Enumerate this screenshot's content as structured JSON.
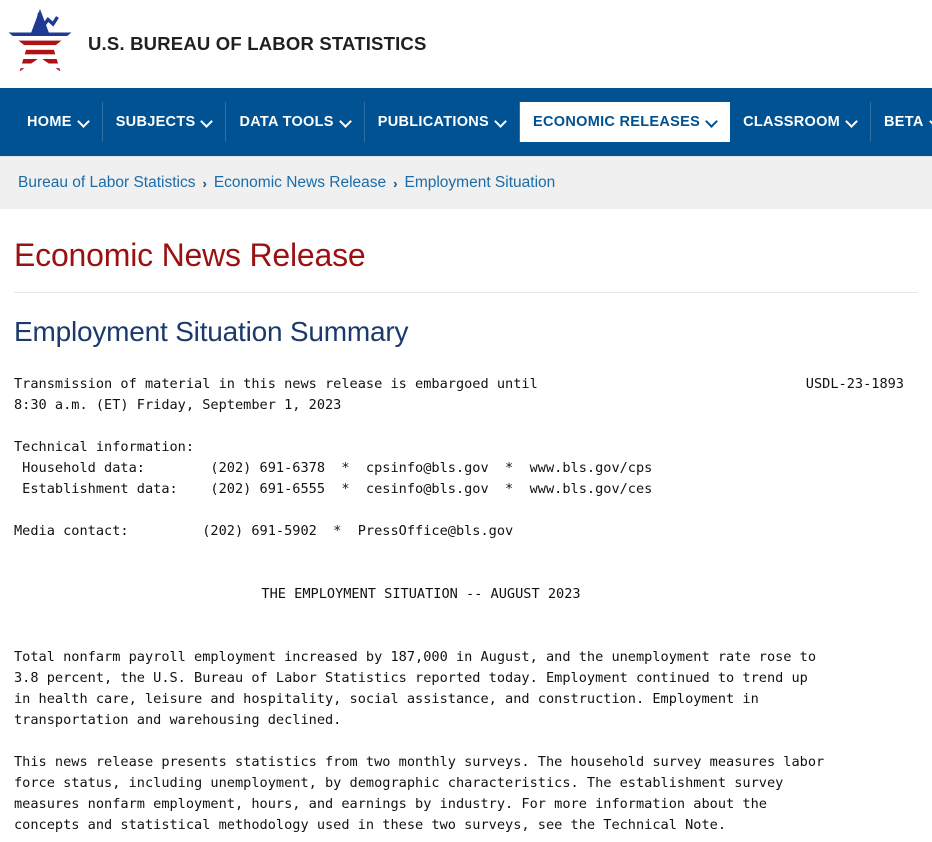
{
  "masthead": {
    "agency_name": "U.S. BUREAU OF LABOR STATISTICS",
    "logo_icon": "bls-star-chart-logo"
  },
  "nav": {
    "items": [
      {
        "label": "HOME",
        "has_caret": true,
        "active": false
      },
      {
        "label": "SUBJECTS",
        "has_caret": true,
        "active": false
      },
      {
        "label": "DATA TOOLS",
        "has_caret": true,
        "active": false
      },
      {
        "label": "PUBLICATIONS",
        "has_caret": true,
        "active": false
      },
      {
        "label": "ECONOMIC RELEASES",
        "has_caret": true,
        "active": true
      },
      {
        "label": "CLASSROOM",
        "has_caret": true,
        "active": false
      },
      {
        "label": "BETA",
        "has_caret": true,
        "active": false
      }
    ],
    "background_color": "#005293",
    "active_background_color": "#ffffff",
    "active_text_color": "#00518f"
  },
  "breadcrumb": {
    "items": [
      "Bureau of Labor Statistics",
      "Economic News Release",
      "Employment Situation"
    ],
    "separator": "›",
    "link_color": "#1b6ca8",
    "background_color": "#f0f0f0"
  },
  "page": {
    "release_title": "Economic News Release",
    "release_title_color": "#9b1111",
    "heading": "Employment Situation Summary",
    "heading_color": "#1b3a6b"
  },
  "release": {
    "embargo_line_1": "Transmission of material in this news release is embargoed until",
    "embargo_line_2": "8:30 a.m. (ET) Friday, September 1, 2023",
    "usdl_number": "USDL-23-1893",
    "technical_information_label": "Technical information:",
    "contacts": [
      {
        "label": " Household data:",
        "phone": "(202) 691-6378",
        "email": "cpsinfo@bls.gov",
        "url": "www.bls.gov/cps"
      },
      {
        "label": " Establishment data:",
        "phone": "(202) 691-6555",
        "email": "cesinfo@bls.gov",
        "url": "www.bls.gov/ces"
      }
    ],
    "media_contact": {
      "label": "Media contact:",
      "phone": "(202) 691-5902",
      "email": "PressOffice@bls.gov"
    },
    "contact_block": " Household data:        (202) 691-6378  *  cpsinfo@bls.gov  *  www.bls.gov/cps\n Establishment data:    (202) 691-6555  *  cesinfo@bls.gov  *  www.bls.gov/ces",
    "media_contact_line": "Media contact:         (202) 691-5902  *  PressOffice@bls.gov",
    "centered_title": "THE EMPLOYMENT SITUATION -- AUGUST 2023",
    "paragraph_1": "Total nonfarm payroll employment increased by 187,000 in August, and the unemployment rate rose to\n3.8 percent, the U.S. Bureau of Labor Statistics reported today. Employment continued to trend up\nin health care, leisure and hospitality, social assistance, and construction. Employment in\ntransportation and warehousing declined.",
    "paragraph_2": "This news release presents statistics from two monthly surveys. The household survey measures labor\nforce status, including unemployment, by demographic characteristics. The establishment survey\nmeasures nonfarm employment, hours, and earnings by industry. For more information about the\nconcepts and statistical methodology used in these two surveys, see the Technical Note."
  }
}
